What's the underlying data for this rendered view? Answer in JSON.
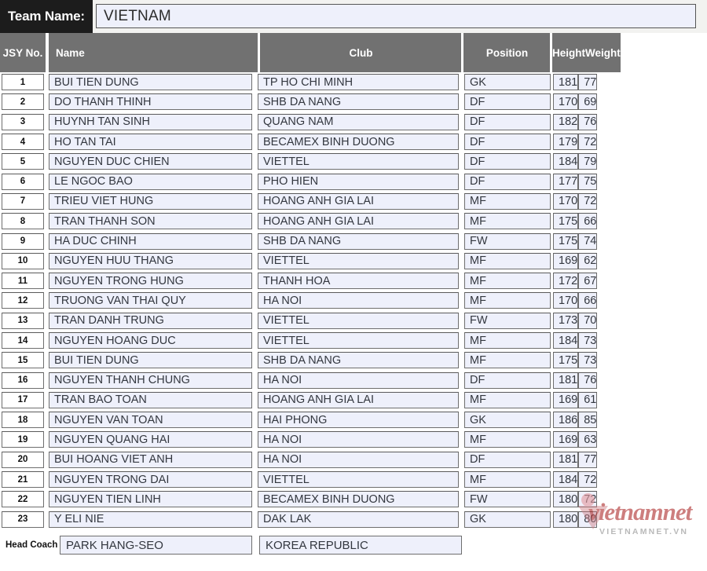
{
  "header": {
    "team_label": "Team Name:",
    "team_value": "VIETNAM"
  },
  "table": {
    "columns": [
      {
        "key": "no",
        "label": "JSY No."
      },
      {
        "key": "name",
        "label": "Name"
      },
      {
        "key": "club",
        "label": "Club"
      },
      {
        "key": "pos",
        "label": "Position"
      },
      {
        "key": "height",
        "label": "Height"
      },
      {
        "key": "weight",
        "label": "Weight"
      }
    ],
    "rows": [
      {
        "no": "1",
        "name": "BUI TIEN DUNG",
        "club": "TP HO CHI MINH",
        "pos": "GK",
        "height": "181",
        "weight": "77"
      },
      {
        "no": "2",
        "name": "DO THANH THINH",
        "club": "SHB DA NANG",
        "pos": "DF",
        "height": "170",
        "weight": "69"
      },
      {
        "no": "3",
        "name": "HUYNH TAN SINH",
        "club": "QUANG NAM",
        "pos": "DF",
        "height": "182",
        "weight": "76"
      },
      {
        "no": "4",
        "name": "HO TAN TAI",
        "club": "BECAMEX BINH DUONG",
        "pos": "DF",
        "height": "179",
        "weight": "72"
      },
      {
        "no": "5",
        "name": "NGUYEN DUC CHIEN",
        "club": "VIETTEL",
        "pos": "DF",
        "height": "184",
        "weight": "79"
      },
      {
        "no": "6",
        "name": "LE NGOC BAO",
        "club": "PHO HIEN",
        "pos": "DF",
        "height": "177",
        "weight": "75"
      },
      {
        "no": "7",
        "name": "TRIEU VIET HUNG",
        "club": "HOANG ANH GIA LAI",
        "pos": "MF",
        "height": "170",
        "weight": "72"
      },
      {
        "no": "8",
        "name": "TRAN THANH SON",
        "club": "HOANG ANH GIA LAI",
        "pos": "MF",
        "height": "175",
        "weight": "66"
      },
      {
        "no": "9",
        "name": "HA DUC CHINH",
        "club": "SHB DA NANG",
        "pos": "FW",
        "height": "175",
        "weight": "74"
      },
      {
        "no": "10",
        "name": "NGUYEN HUU THANG",
        "club": "VIETTEL",
        "pos": "MF",
        "height": "169",
        "weight": "62"
      },
      {
        "no": "11",
        "name": "NGUYEN TRONG HUNG",
        "club": " THANH HOA",
        "pos": "MF",
        "height": "172",
        "weight": "67"
      },
      {
        "no": "12",
        "name": "TRUONG VAN THAI QUY",
        "club": "HA NOI",
        "pos": "MF",
        "height": "170",
        "weight": "66"
      },
      {
        "no": "13",
        "name": "TRAN DANH TRUNG",
        "club": "VIETTEL",
        "pos": "FW",
        "height": "173",
        "weight": "70"
      },
      {
        "no": "14",
        "name": "NGUYEN HOANG DUC",
        "club": "VIETTEL",
        "pos": "MF",
        "height": "184",
        "weight": "73"
      },
      {
        "no": "15",
        "name": "BUI TIEN DUNG",
        "club": "SHB DA NANG",
        "pos": "MF",
        "height": "175",
        "weight": "73"
      },
      {
        "no": "16",
        "name": "NGUYEN THANH CHUNG",
        "club": "HA NOI",
        "pos": "DF",
        "height": "181",
        "weight": "76"
      },
      {
        "no": "17",
        "name": "TRAN BAO TOAN",
        "club": "HOANG ANH GIA LAI",
        "pos": "MF",
        "height": "169",
        "weight": "61"
      },
      {
        "no": "18",
        "name": "NGUYEN VAN TOAN",
        "club": "HAI PHONG",
        "pos": "GK",
        "height": "186",
        "weight": "85"
      },
      {
        "no": "19",
        "name": "NGUYEN QUANG HAI",
        "club": "HA NOI",
        "pos": "MF",
        "height": "169",
        "weight": "63"
      },
      {
        "no": "20",
        "name": "BUI HOANG VIET ANH",
        "club": "HA NOI",
        "pos": "DF",
        "height": "181",
        "weight": "77"
      },
      {
        "no": "21",
        "name": "NGUYEN TRONG DAI",
        "club": "VIETTEL",
        "pos": "MF",
        "height": "184",
        "weight": "72"
      },
      {
        "no": "22",
        "name": "NGUYEN TIEN LINH",
        "club": "BECAMEX BINH DUONG",
        "pos": "FW",
        "height": "180",
        "weight": "72"
      },
      {
        "no": "23",
        "name": "Y ELI NIE",
        "club": "DAK LAK",
        "pos": "GK",
        "height": "180",
        "weight": "80"
      }
    ]
  },
  "footer": {
    "coach_label": "Head Coach",
    "coach_name": "PARK HANG-SEO",
    "coach_nationality": "KOREA REPUBLIC"
  },
  "watermark": {
    "main": "vietnamnet",
    "sub": "VIETNAMNET.VN"
  },
  "colors": {
    "header_bg": "#717171",
    "label_bg": "#1c1c1c",
    "cell_bg": "#eef0fb",
    "num_cell_bg": "#ffffff",
    "border": "#6e6e6e",
    "text": "#33373f",
    "watermark_red": "#b03030"
  }
}
